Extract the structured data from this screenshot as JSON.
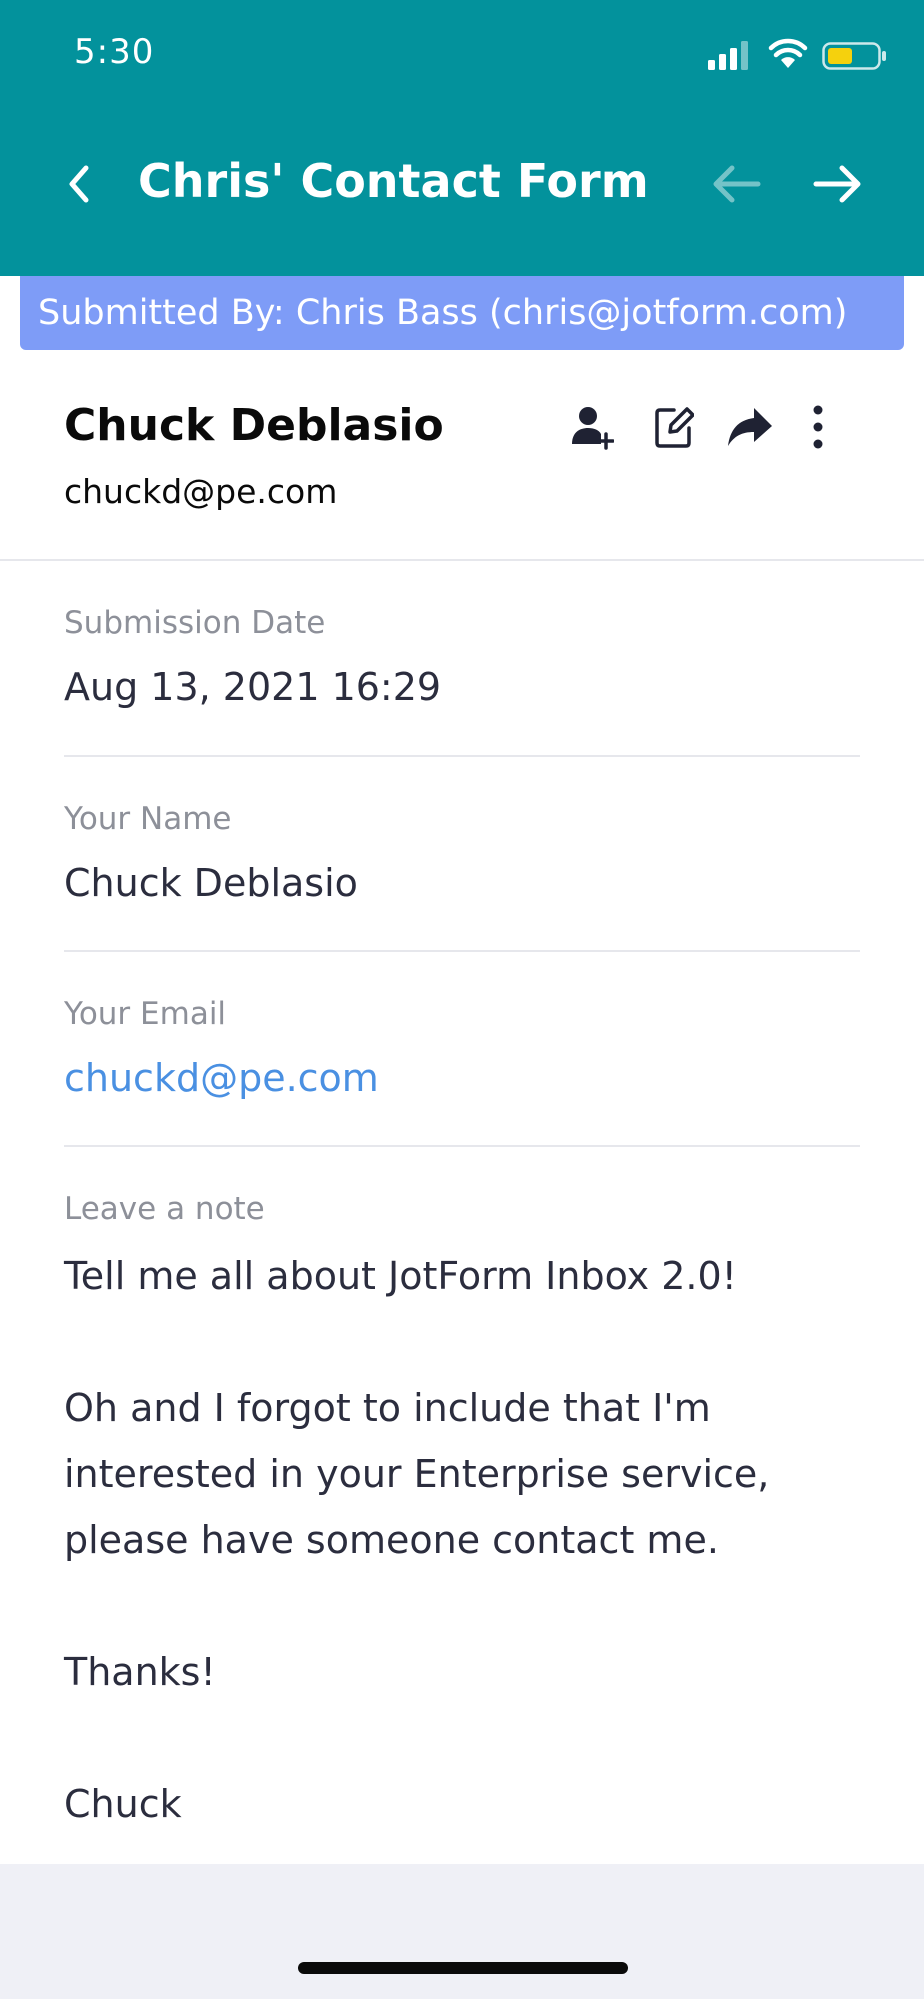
{
  "status_bar": {
    "time": "5:30",
    "icons": [
      "signal-icon",
      "wifi-icon",
      "battery-icon"
    ],
    "battery_color": "#f5d10d"
  },
  "header": {
    "title": "Chris' Contact Form",
    "background_color": "#03929c",
    "back_icon": "chevron-left-icon",
    "prev_icon": "arrow-left-icon",
    "next_icon": "arrow-right-icon",
    "prev_enabled": false,
    "next_enabled": true
  },
  "banner": {
    "text": "Submitted By: Chris Bass (chris@jotform.com)",
    "color": "#7e9cf7"
  },
  "contact": {
    "name": "Chuck Deblasio",
    "email": "chuckd@pe.com",
    "actions": [
      "add-contact-icon",
      "edit-icon",
      "share-icon",
      "more-icon"
    ]
  },
  "fields": [
    {
      "label": "Submission Date",
      "value": "Aug 13, 2021 16:29"
    },
    {
      "label": "Your Name",
      "value": "Chuck Deblasio"
    },
    {
      "label": "Your Email",
      "value": "chuckd@pe.com",
      "link_color": "#4a90e2"
    },
    {
      "label": "Leave a note",
      "lines": [
        "Tell me all about JotForm Inbox 2.0!",
        "",
        "Oh and I forgot to include that I'm",
        "interested in your Enterprise service,",
        "please have someone contact me.",
        "",
        "Thanks!",
        "",
        "Chuck"
      ]
    }
  ]
}
